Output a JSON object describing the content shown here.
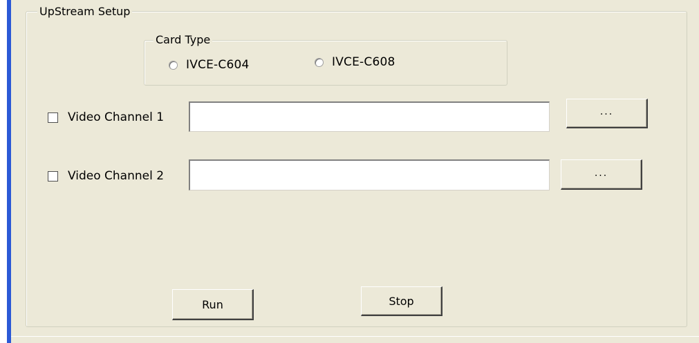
{
  "upstream_setup": {
    "title": "UpStream Setup",
    "card_type": {
      "title": "Card Type",
      "options": [
        {
          "label": "IVCE-C604",
          "selected": false
        },
        {
          "label": "IVCE-C608",
          "selected": false
        }
      ]
    },
    "channels": [
      {
        "label": "Video Channel 1",
        "checked": false,
        "value": "",
        "browse_label": "..."
      },
      {
        "label": "Video Channel 2",
        "checked": false,
        "value": "",
        "browse_label": "..."
      }
    ],
    "actions": {
      "run_label": "Run",
      "stop_label": "Stop"
    }
  },
  "colors": {
    "window_background": "#ece9d8",
    "accent_edge": "#2b59d6",
    "field_background": "#ffffff"
  }
}
